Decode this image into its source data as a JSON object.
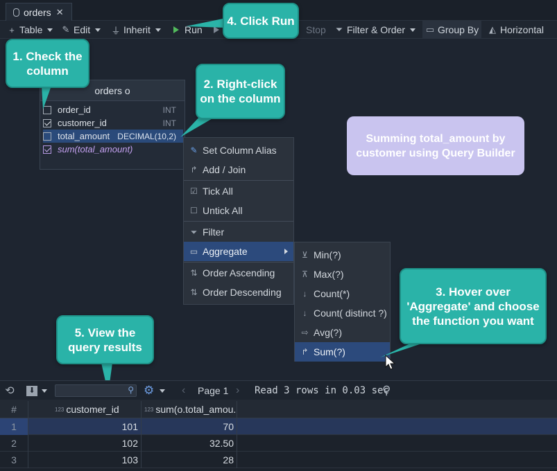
{
  "tab": {
    "title": "orders"
  },
  "toolbar": {
    "table": "Table",
    "edit": "Edit",
    "inherit": "Inherit",
    "run": "Run",
    "stop": "Stop",
    "filter_order": "Filter & Order",
    "group_by": "Group By",
    "horizontal": "Horizontal"
  },
  "diagram_table": {
    "title": "orders o",
    "columns": [
      {
        "name": "order_id",
        "type": "INT",
        "checked": false
      },
      {
        "name": "customer_id",
        "type": "INT",
        "checked": true
      },
      {
        "name": "total_amount",
        "type": "DECIMAL(10,2)",
        "checked": false
      },
      {
        "name": "sum(total_amount)",
        "type": "",
        "checked": true
      }
    ]
  },
  "context_menu": {
    "items": [
      "Set Column Alias",
      "Add / Join",
      "Tick All",
      "Untick All",
      "Filter",
      "Aggregate",
      "Order Ascending",
      "Order Descending"
    ]
  },
  "aggregate_menu": {
    "items": [
      "Min(?)",
      "Max(?)",
      "Count(*)",
      "Count( distinct ?)",
      "Avg(?)",
      "Sum(?)"
    ]
  },
  "callouts": {
    "step1": "1. Check the column",
    "step2": "2. Right-click on the column",
    "step3": "3. Hover over 'Aggregate' and choose the function you want",
    "step4": "4. Click Run",
    "step5": "5. View the query results",
    "note": "Summing total_amount by customer using Query Builder"
  },
  "results_toolbar": {
    "page": "Page 1",
    "status": "Read 3 rows in 0.03 sec"
  },
  "results": {
    "headers": [
      "#",
      "customer_id",
      "sum(o.total_amou..."
    ],
    "type_tag": "123",
    "rows": [
      {
        "n": "1",
        "customer_id": "101",
        "sum": "70"
      },
      {
        "n": "2",
        "customer_id": "102",
        "sum": "32.50"
      },
      {
        "n": "3",
        "customer_id": "103",
        "sum": "28"
      }
    ]
  },
  "colors": {
    "callout": "#2ab3a8",
    "note": "#c9c4ef",
    "selection": "#2c4a7c",
    "run": "#52b95c"
  }
}
